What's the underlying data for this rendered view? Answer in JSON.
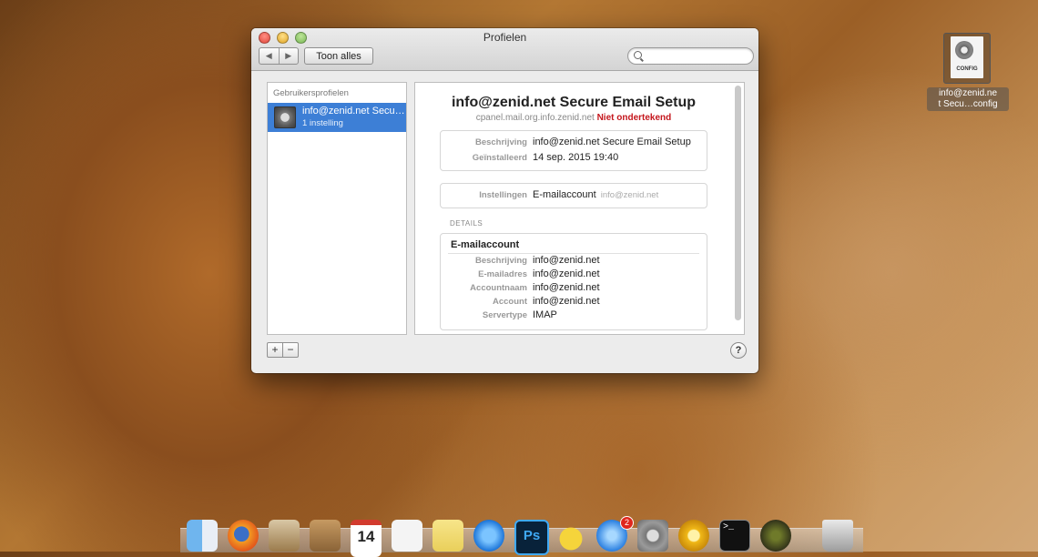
{
  "window": {
    "title": "Profielen",
    "nav_back": "◀",
    "nav_forward": "▶",
    "show_all_label": "Toon alles",
    "search_placeholder": ""
  },
  "sidebar": {
    "header": "Gebruikersprofielen",
    "items": [
      {
        "title": "info@zenid.net Secu…",
        "subtitle": "1 instelling",
        "icon": "config-gear-icon",
        "selected": true
      }
    ],
    "add_label": "+",
    "remove_label": "−"
  },
  "profile": {
    "title": "info@zenid.net Secure Email Setup",
    "source": "cpanel.mail.org.info.zenid.net",
    "signature_status": "Niet ondertekend",
    "summary": [
      {
        "key": "Beschrijving",
        "value": "info@zenid.net Secure Email Setup"
      },
      {
        "key": "Geïnstalleerd",
        "value": "14 sep. 2015 19:40"
      }
    ],
    "settings": {
      "key": "Instellingen",
      "value": "E-mailaccount",
      "extra": "info@zenid.net"
    },
    "details_label": "DETAILS",
    "email_account": {
      "header": "E-mailaccount",
      "rows": [
        {
          "key": "Beschrijving",
          "value": "info@zenid.net"
        },
        {
          "key": "E-mailadres",
          "value": "info@zenid.net"
        },
        {
          "key": "Accountnaam",
          "value": "info@zenid.net"
        },
        {
          "key": "Account",
          "value": "info@zenid.net"
        },
        {
          "key": "Servertype",
          "value": "IMAP"
        }
      ]
    }
  },
  "help_label": "?",
  "desktop_file": {
    "badge_text": "CONFIG",
    "name_line1": "info@zenid.ne",
    "name_line2": "t Secu…config"
  },
  "dock": {
    "calendar_day": "14",
    "app_store_badge": "2",
    "photoshop_label": "Ps",
    "terminal_prompt": ">_",
    "icons": [
      "finder-icon",
      "firefox-icon",
      "mail-icon",
      "contacts-icon",
      "calendar-icon",
      "reminders-icon",
      "notes-icon",
      "itunes-icon",
      "photoshop-icon",
      "cyberduck-icon",
      "app-store-icon",
      "system-preferences-icon",
      "vlc-icon",
      "terminal-icon",
      "radar-icon",
      "trash-icon"
    ]
  },
  "colors": {
    "selection": "#3d7fd6",
    "unsigned_red": "#c4161c"
  }
}
